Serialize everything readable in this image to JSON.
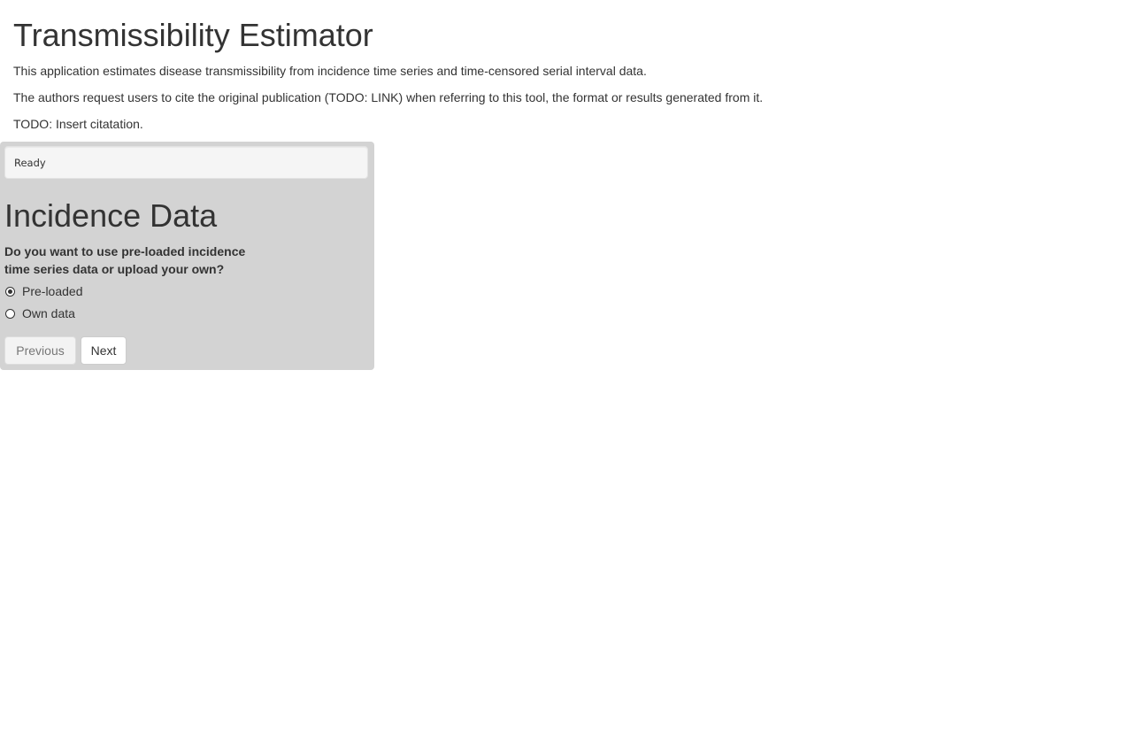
{
  "header": {
    "title": "Transmissibility Estimator",
    "description": "This application estimates disease transmissibility from incidence time series and time-censored serial interval data.",
    "citation_request": "The authors request users to cite the original publication (TODO: LINK) when referring to this tool, the format or results generated from it.",
    "citation_todo": "TODO: Insert citatation."
  },
  "panel": {
    "status": "Ready",
    "section_title": "Incidence Data",
    "question": "Do you want to use pre-loaded incidence time series data or upload your own?",
    "options": [
      {
        "label": "Pre-loaded",
        "selected": true
      },
      {
        "label": "Own data",
        "selected": false
      }
    ],
    "buttons": {
      "previous": "Previous",
      "next": "Next"
    }
  }
}
